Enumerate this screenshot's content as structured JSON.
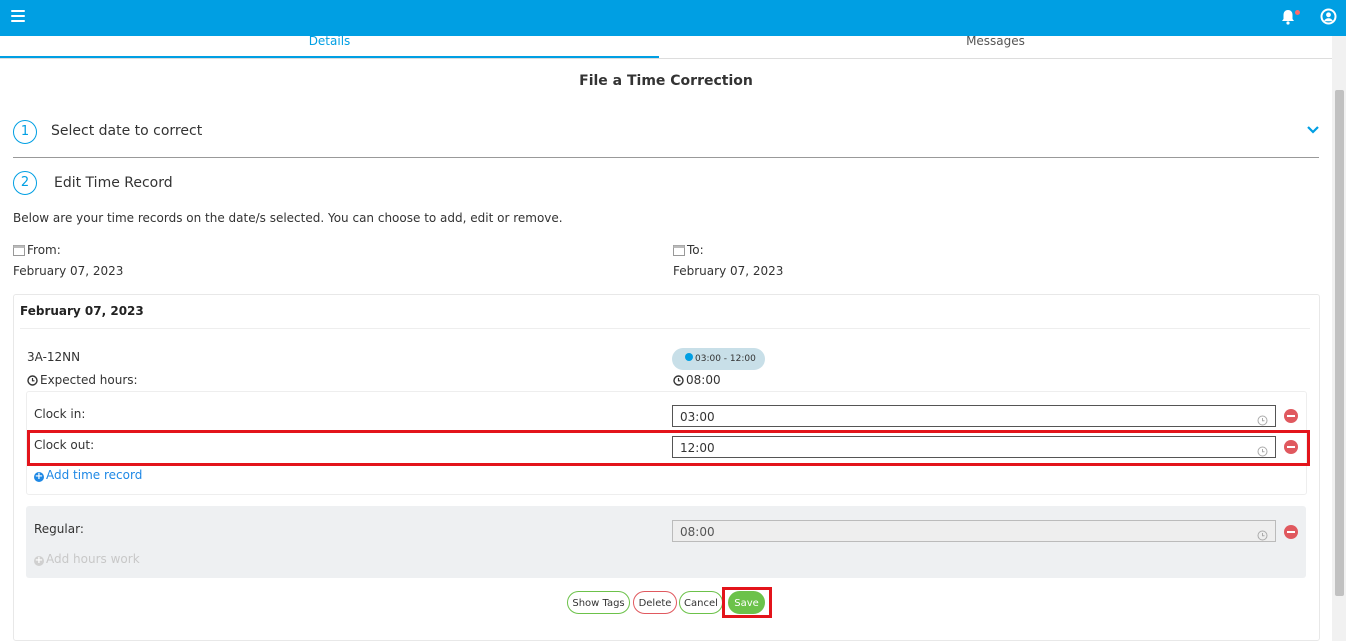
{
  "header": {
    "menu_icon": "hamburger-icon",
    "notification_icon": "bell-icon",
    "user_icon": "user-circle-icon"
  },
  "tabs": [
    {
      "label": "Details",
      "active": true
    },
    {
      "label": "Messages",
      "active": false
    }
  ],
  "page_title": "File a Time Correction",
  "steps": [
    {
      "number": "1",
      "label": "Select date to correct"
    },
    {
      "number": "2",
      "label": "Edit Time Record"
    }
  ],
  "description": "Below are your time records on the date/s selected. You can choose to add, edit or remove.",
  "from": {
    "label": "From:",
    "value": "February 07, 2023"
  },
  "to": {
    "label": "To:",
    "value": "February 07, 2023"
  },
  "record": {
    "date": "February 07, 2023",
    "shift_code": "3A-12NN",
    "shift_pill": "03:00 - 12:00",
    "expected_hours_label": "Expected hours:",
    "expected_hours_value": "08:00",
    "clock_in_label": "Clock in:",
    "clock_in_value": "03:00",
    "clock_out_label": "Clock out:",
    "clock_out_value": "12:00",
    "add_time_record": "Add time record",
    "regular_label": "Regular:",
    "regular_value": "08:00",
    "add_hours_work": "Add hours work"
  },
  "buttons": {
    "show_tags": "Show Tags",
    "delete": "Delete",
    "cancel": "Cancel",
    "save": "Save"
  },
  "colors": {
    "primary": "#009fe3",
    "highlight": "#e3141b",
    "save": "#6cc24a",
    "danger": "#e0595f"
  }
}
